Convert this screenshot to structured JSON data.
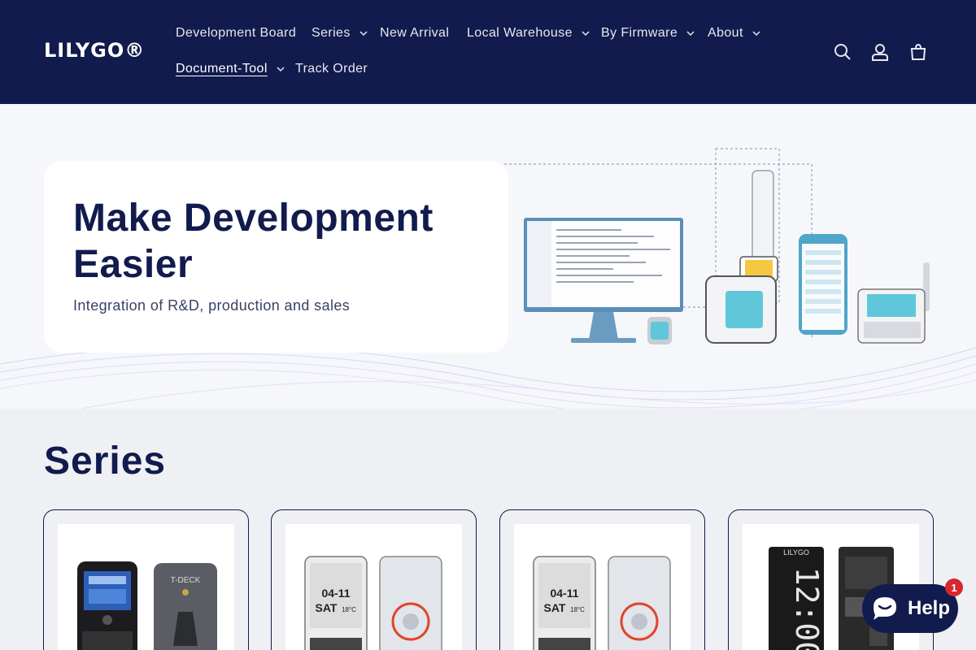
{
  "header": {
    "logo": "LILYGO®",
    "nav": [
      {
        "label": "Development Board"
      },
      {
        "label": "Series"
      },
      {
        "label": "New Arrival"
      },
      {
        "label": "Local Warehouse"
      },
      {
        "label": "By Firmware"
      },
      {
        "label": "About"
      },
      {
        "label": "Document-Tool"
      },
      {
        "label": "Track Order"
      }
    ],
    "icons": [
      "search-icon",
      "account-icon",
      "cart-icon"
    ]
  },
  "hero": {
    "title": "Make Development Easier",
    "subtitle": "Integration of R&D, production and sales"
  },
  "series": {
    "title": "Series",
    "cards": [
      {
        "image": "t-deck-product"
      },
      {
        "image": "t-deck-pro-product"
      },
      {
        "image": "t-deck-pro-product"
      },
      {
        "image": "t-display-clock-product"
      }
    ]
  },
  "help": {
    "label": "Help",
    "badge": "1"
  },
  "colors": {
    "brand_navy": "#121b4d",
    "hero_bg": "#f5f7fb",
    "page_bg": "#eef0f4",
    "badge_red": "#d9262c",
    "device_cyan": "#5fc7d9"
  }
}
